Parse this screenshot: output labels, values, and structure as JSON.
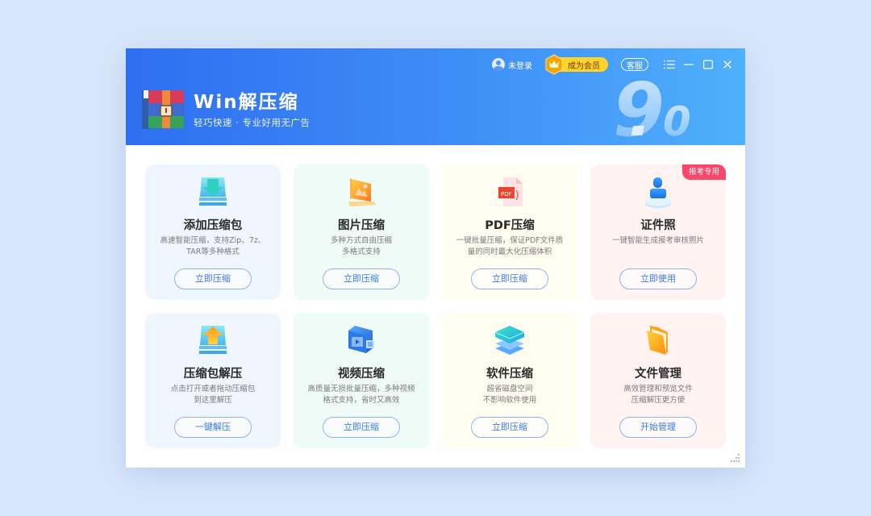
{
  "topbar": {
    "login_label": "未登录",
    "vip_label": "成为会员",
    "service_label": "客服",
    "menu_icon": "menu-icon",
    "minimize_icon": "minimize-icon",
    "maximize_icon": "maximize-icon",
    "close_icon": "close-icon"
  },
  "brand": {
    "title": "Win解压缩",
    "subtitle": "轻巧快速 · 专业好用无广告",
    "version_major": "9",
    "version_minor": "0"
  },
  "colors": {
    "header_start": "#2e6ff0",
    "header_end": "#4fb0fb",
    "vip_yellow": "#ffd42a",
    "badge_red": "#f8476b",
    "button_text": "#3a78e6"
  },
  "cards": [
    {
      "title": "添加压缩包",
      "desc1": "高速智能压缩，支持Zip、7z、",
      "desc2": "TAR等多种格式",
      "button": "立即压缩",
      "icon": "add-archive-icon"
    },
    {
      "title": "图片压缩",
      "desc1": "多种方式自由压缩",
      "desc2": "多格式支持",
      "button": "立即压缩",
      "icon": "image-icon"
    },
    {
      "title": "PDF压缩",
      "desc1": "一键批量压缩，保证PDF文件质",
      "desc2": "量的同时最大化压缩体积",
      "button": "立即压缩",
      "icon": "pdf-icon"
    },
    {
      "title": "证件照",
      "desc1": "一键智能生成报考审核照片",
      "desc2": "",
      "button": "立即使用",
      "icon": "id-photo-icon",
      "badge": "报考专用"
    },
    {
      "title": "压缩包解压",
      "desc1": "点击打开或者拖动压缩包",
      "desc2": "到这里解压",
      "button": "一键解压",
      "icon": "extract-icon"
    },
    {
      "title": "视频压缩",
      "desc1": "高质量无损批量压缩，多种视频",
      "desc2": "格式支持，省时又高效",
      "button": "立即压缩",
      "icon": "video-icon"
    },
    {
      "title": "软件压缩",
      "desc1": "超省磁盘空间",
      "desc2": "不影响软件使用",
      "button": "立即压缩",
      "icon": "software-icon"
    },
    {
      "title": "文件管理",
      "desc1": "高效管理和预览文件",
      "desc2": "压缩解压更方便",
      "button": "开始管理",
      "icon": "folder-icon"
    }
  ]
}
